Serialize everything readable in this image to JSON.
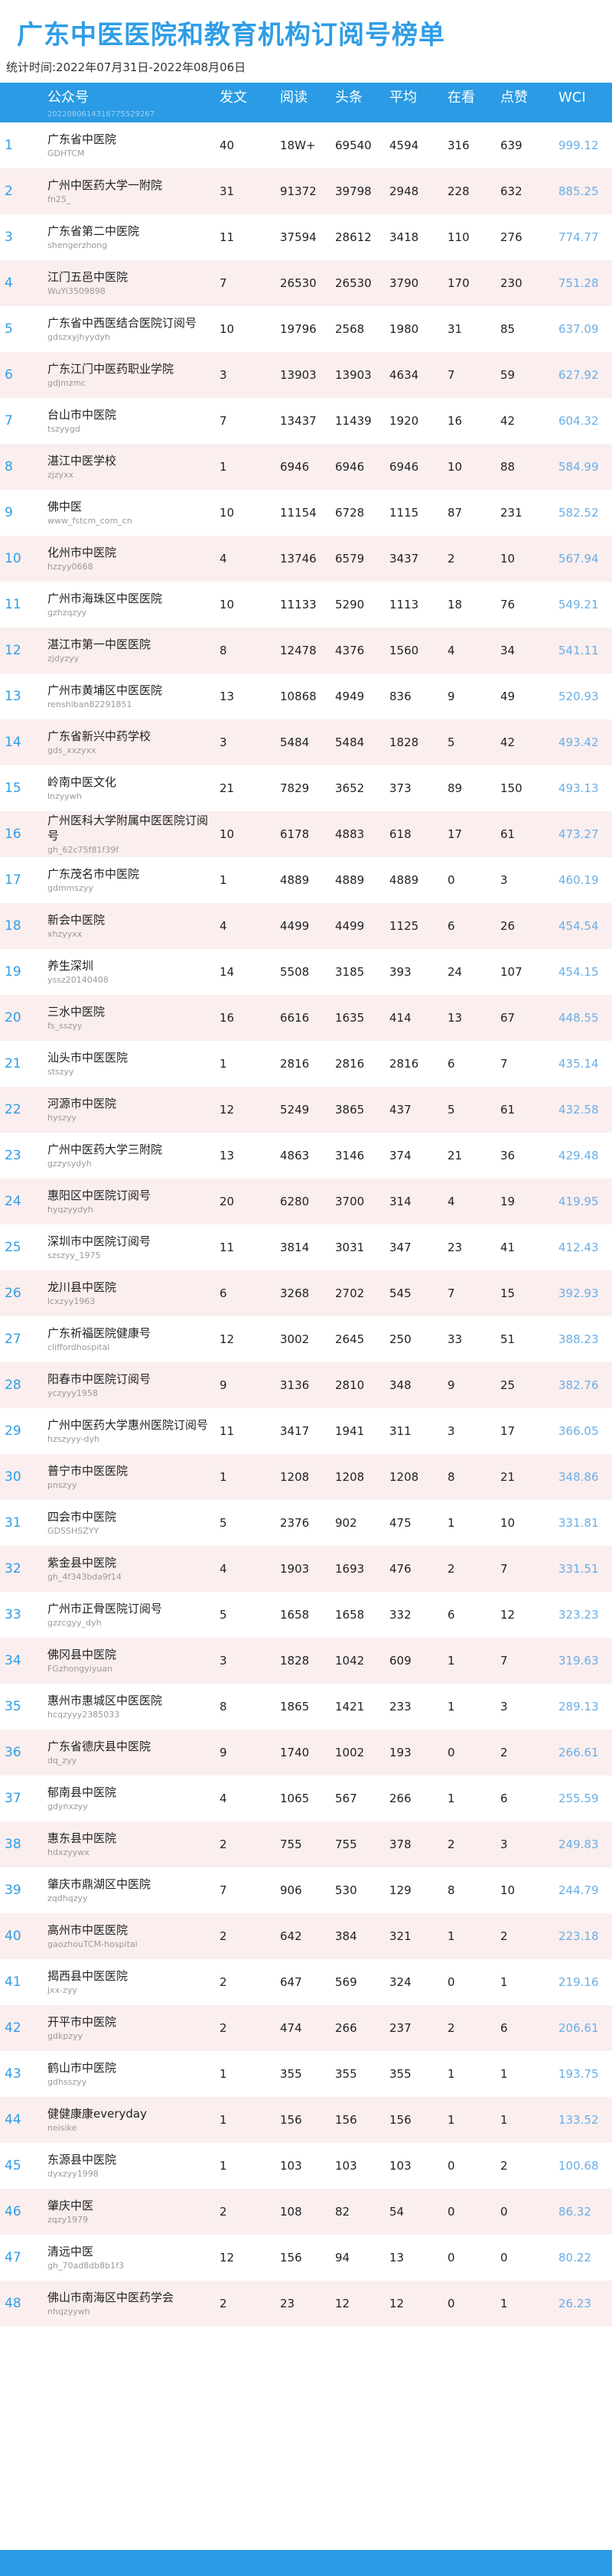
{
  "title": "广东中医医院和教育机构订阅号榜单",
  "period": "统计时间:2022年07月31日-2022年08月06日",
  "header": {
    "account": "公众号",
    "account_sub": "2022080614316775529267",
    "posts": "发文",
    "reads": "阅读",
    "headline": "头条",
    "avg": "平均",
    "looking": "在看",
    "likes": "点赞",
    "wci": "WCI"
  },
  "colors": {
    "accent": "#2a9be4",
    "title": "#2f9de6",
    "alt_row": "#fbeeee",
    "wci_text": "#6aaee6"
  },
  "rows": [
    {
      "rank": "1",
      "name": "广东省中医院",
      "acct": "GDHTCM",
      "posts": "40",
      "reads": "18W+",
      "head": "69540",
      "avg": "4594",
      "look": "316",
      "like": "639",
      "wci": "999.12"
    },
    {
      "rank": "2",
      "name": "广州中医药大学一附院",
      "acct": "fn25_",
      "posts": "31",
      "reads": "91372",
      "head": "39798",
      "avg": "2948",
      "look": "228",
      "like": "632",
      "wci": "885.25"
    },
    {
      "rank": "3",
      "name": "广东省第二中医院",
      "acct": "shengerzhong",
      "posts": "11",
      "reads": "37594",
      "head": "28612",
      "avg": "3418",
      "look": "110",
      "like": "276",
      "wci": "774.77"
    },
    {
      "rank": "4",
      "name": "江门五邑中医院",
      "acct": "WuYi3509898",
      "posts": "7",
      "reads": "26530",
      "head": "26530",
      "avg": "3790",
      "look": "170",
      "like": "230",
      "wci": "751.28"
    },
    {
      "rank": "5",
      "name": "广东省中西医结合医院订阅号",
      "acct": "gdszxyjhyydyh",
      "posts": "10",
      "reads": "19796",
      "head": "2568",
      "avg": "1980",
      "look": "31",
      "like": "85",
      "wci": "637.09"
    },
    {
      "rank": "6",
      "name": "广东江门中医药职业学院",
      "acct": "gdjmzmc",
      "posts": "3",
      "reads": "13903",
      "head": "13903",
      "avg": "4634",
      "look": "7",
      "like": "59",
      "wci": "627.92"
    },
    {
      "rank": "7",
      "name": "台山市中医院",
      "acct": "tszyygd",
      "posts": "7",
      "reads": "13437",
      "head": "11439",
      "avg": "1920",
      "look": "16",
      "like": "42",
      "wci": "604.32"
    },
    {
      "rank": "8",
      "name": "湛江中医学校",
      "acct": "zjzyxx",
      "posts": "1",
      "reads": "6946",
      "head": "6946",
      "avg": "6946",
      "look": "10",
      "like": "88",
      "wci": "584.99"
    },
    {
      "rank": "9",
      "name": "佛中医",
      "acct": "www_fstcm_com_cn",
      "posts": "10",
      "reads": "11154",
      "head": "6728",
      "avg": "1115",
      "look": "87",
      "like": "231",
      "wci": "582.52"
    },
    {
      "rank": "10",
      "name": "化州市中医院",
      "acct": "hzzyy0668",
      "posts": "4",
      "reads": "13746",
      "head": "6579",
      "avg": "3437",
      "look": "2",
      "like": "10",
      "wci": "567.94"
    },
    {
      "rank": "11",
      "name": "广州市海珠区中医医院",
      "acct": "gzhzqzyy",
      "posts": "10",
      "reads": "11133",
      "head": "5290",
      "avg": "1113",
      "look": "18",
      "like": "76",
      "wci": "549.21"
    },
    {
      "rank": "12",
      "name": "湛江市第一中医医院",
      "acct": "zjdyzyy",
      "posts": "8",
      "reads": "12478",
      "head": "4376",
      "avg": "1560",
      "look": "4",
      "like": "34",
      "wci": "541.11"
    },
    {
      "rank": "13",
      "name": "广州市黄埔区中医医院",
      "acct": "renshiban82291851",
      "posts": "13",
      "reads": "10868",
      "head": "4949",
      "avg": "836",
      "look": "9",
      "like": "49",
      "wci": "520.93"
    },
    {
      "rank": "14",
      "name": "广东省新兴中药学校",
      "acct": "gds_xxzyxx",
      "posts": "3",
      "reads": "5484",
      "head": "5484",
      "avg": "1828",
      "look": "5",
      "like": "42",
      "wci": "493.42"
    },
    {
      "rank": "15",
      "name": "岭南中医文化",
      "acct": "lnzyywh",
      "posts": "21",
      "reads": "7829",
      "head": "3652",
      "avg": "373",
      "look": "89",
      "like": "150",
      "wci": "493.13"
    },
    {
      "rank": "16",
      "name": "广州医科大学附属中医医院订阅号",
      "acct": "gh_62c75f81f39f",
      "posts": "10",
      "reads": "6178",
      "head": "4883",
      "avg": "618",
      "look": "17",
      "like": "61",
      "wci": "473.27"
    },
    {
      "rank": "17",
      "name": "广东茂名市中医院",
      "acct": "gdmmszyy",
      "posts": "1",
      "reads": "4889",
      "head": "4889",
      "avg": "4889",
      "look": "0",
      "like": "3",
      "wci": "460.19"
    },
    {
      "rank": "18",
      "name": "新会中医院",
      "acct": "xhzyyxx",
      "posts": "4",
      "reads": "4499",
      "head": "4499",
      "avg": "1125",
      "look": "6",
      "like": "26",
      "wci": "454.54"
    },
    {
      "rank": "19",
      "name": "养生深圳",
      "acct": "yssz20140408",
      "posts": "14",
      "reads": "5508",
      "head": "3185",
      "avg": "393",
      "look": "24",
      "like": "107",
      "wci": "454.15"
    },
    {
      "rank": "20",
      "name": "三水中医院",
      "acct": "fs_sszyy",
      "posts": "16",
      "reads": "6616",
      "head": "1635",
      "avg": "414",
      "look": "13",
      "like": "67",
      "wci": "448.55"
    },
    {
      "rank": "21",
      "name": "汕头市中医医院",
      "acct": "stszyy",
      "posts": "1",
      "reads": "2816",
      "head": "2816",
      "avg": "2816",
      "look": "6",
      "like": "7",
      "wci": "435.14"
    },
    {
      "rank": "22",
      "name": "河源市中医院",
      "acct": "hyszyy",
      "posts": "12",
      "reads": "5249",
      "head": "3865",
      "avg": "437",
      "look": "5",
      "like": "61",
      "wci": "432.58"
    },
    {
      "rank": "23",
      "name": "广州中医药大学三附院",
      "acct": "gzzysydyh",
      "posts": "13",
      "reads": "4863",
      "head": "3146",
      "avg": "374",
      "look": "21",
      "like": "36",
      "wci": "429.48"
    },
    {
      "rank": "24",
      "name": "惠阳区中医院订阅号",
      "acct": "hyqzyydyh",
      "posts": "20",
      "reads": "6280",
      "head": "3700",
      "avg": "314",
      "look": "4",
      "like": "19",
      "wci": "419.95"
    },
    {
      "rank": "25",
      "name": "深圳市中医院订阅号",
      "acct": "szszyy_1975",
      "posts": "11",
      "reads": "3814",
      "head": "3031",
      "avg": "347",
      "look": "23",
      "like": "41",
      "wci": "412.43"
    },
    {
      "rank": "26",
      "name": "龙川县中医院",
      "acct": "lcxzyy1963",
      "posts": "6",
      "reads": "3268",
      "head": "2702",
      "avg": "545",
      "look": "7",
      "like": "15",
      "wci": "392.93"
    },
    {
      "rank": "27",
      "name": "广东祈福医院健康号",
      "acct": "cliffordhospital",
      "posts": "12",
      "reads": "3002",
      "head": "2645",
      "avg": "250",
      "look": "33",
      "like": "51",
      "wci": "388.23"
    },
    {
      "rank": "28",
      "name": "阳春市中医院订阅号",
      "acct": "yczyyy1958",
      "posts": "9",
      "reads": "3136",
      "head": "2810",
      "avg": "348",
      "look": "9",
      "like": "25",
      "wci": "382.76"
    },
    {
      "rank": "29",
      "name": "广州中医药大学惠州医院订阅号",
      "acct": "hzszyyy-dyh",
      "posts": "11",
      "reads": "3417",
      "head": "1941",
      "avg": "311",
      "look": "3",
      "like": "17",
      "wci": "366.05"
    },
    {
      "rank": "30",
      "name": "普宁市中医医院",
      "acct": "pnszyy",
      "posts": "1",
      "reads": "1208",
      "head": "1208",
      "avg": "1208",
      "look": "8",
      "like": "21",
      "wci": "348.86"
    },
    {
      "rank": "31",
      "name": "四会市中医院",
      "acct": "GDSSHSZYY",
      "posts": "5",
      "reads": "2376",
      "head": "902",
      "avg": "475",
      "look": "1",
      "like": "10",
      "wci": "331.81"
    },
    {
      "rank": "32",
      "name": "紫金县中医院",
      "acct": "gh_4f343bda9f14",
      "posts": "4",
      "reads": "1903",
      "head": "1693",
      "avg": "476",
      "look": "2",
      "like": "7",
      "wci": "331.51"
    },
    {
      "rank": "33",
      "name": "广州市正骨医院订阅号",
      "acct": "gzzcgyy_dyh",
      "posts": "5",
      "reads": "1658",
      "head": "1658",
      "avg": "332",
      "look": "6",
      "like": "12",
      "wci": "323.23"
    },
    {
      "rank": "34",
      "name": "佛冈县中医院",
      "acct": "FGzhongyiyuan",
      "posts": "3",
      "reads": "1828",
      "head": "1042",
      "avg": "609",
      "look": "1",
      "like": "7",
      "wci": "319.63"
    },
    {
      "rank": "35",
      "name": "惠州市惠城区中医医院",
      "acct": "hcqzyyy2385033",
      "posts": "8",
      "reads": "1865",
      "head": "1421",
      "avg": "233",
      "look": "1",
      "like": "3",
      "wci": "289.13"
    },
    {
      "rank": "36",
      "name": "广东省德庆县中医院",
      "acct": "dq_zyy",
      "posts": "9",
      "reads": "1740",
      "head": "1002",
      "avg": "193",
      "look": "0",
      "like": "2",
      "wci": "266.61"
    },
    {
      "rank": "37",
      "name": "郁南县中医院",
      "acct": "gdynxzyy",
      "posts": "4",
      "reads": "1065",
      "head": "567",
      "avg": "266",
      "look": "1",
      "like": "6",
      "wci": "255.59"
    },
    {
      "rank": "38",
      "name": "惠东县中医院",
      "acct": "hdxzyywx",
      "posts": "2",
      "reads": "755",
      "head": "755",
      "avg": "378",
      "look": "2",
      "like": "3",
      "wci": "249.83"
    },
    {
      "rank": "39",
      "name": "肇庆市鼎湖区中医院",
      "acct": "zqdhqzyy",
      "posts": "7",
      "reads": "906",
      "head": "530",
      "avg": "129",
      "look": "8",
      "like": "10",
      "wci": "244.79"
    },
    {
      "rank": "40",
      "name": "高州市中医医院",
      "acct": "gaozhouTCM-hospital",
      "posts": "2",
      "reads": "642",
      "head": "384",
      "avg": "321",
      "look": "1",
      "like": "2",
      "wci": "223.18"
    },
    {
      "rank": "41",
      "name": "揭西县中医医院",
      "acct": "jxx-zyy",
      "posts": "2",
      "reads": "647",
      "head": "569",
      "avg": "324",
      "look": "0",
      "like": "1",
      "wci": "219.16"
    },
    {
      "rank": "42",
      "name": "开平市中医院",
      "acct": "gdkpzyy",
      "posts": "2",
      "reads": "474",
      "head": "266",
      "avg": "237",
      "look": "2",
      "like": "6",
      "wci": "206.61"
    },
    {
      "rank": "43",
      "name": "鹤山市中医院",
      "acct": "gdhsszyy",
      "posts": "1",
      "reads": "355",
      "head": "355",
      "avg": "355",
      "look": "1",
      "like": "1",
      "wci": "193.75"
    },
    {
      "rank": "44",
      "name": "健健康康everyday",
      "acct": "neisike",
      "posts": "1",
      "reads": "156",
      "head": "156",
      "avg": "156",
      "look": "1",
      "like": "1",
      "wci": "133.52"
    },
    {
      "rank": "45",
      "name": "东源县中医院",
      "acct": "dyxzyy1998",
      "posts": "1",
      "reads": "103",
      "head": "103",
      "avg": "103",
      "look": "0",
      "like": "2",
      "wci": "100.68"
    },
    {
      "rank": "46",
      "name": "肇庆中医",
      "acct": "zqzy1979",
      "posts": "2",
      "reads": "108",
      "head": "82",
      "avg": "54",
      "look": "0",
      "like": "0",
      "wci": "86.32"
    },
    {
      "rank": "47",
      "name": "清远中医",
      "acct": "gh_70ad8db8b1f3",
      "posts": "12",
      "reads": "156",
      "head": "94",
      "avg": "13",
      "look": "0",
      "like": "0",
      "wci": "80.22"
    },
    {
      "rank": "48",
      "name": "佛山市南海区中医药学会",
      "acct": "nhqzyywh",
      "posts": "2",
      "reads": "23",
      "head": "12",
      "avg": "12",
      "look": "0",
      "like": "1",
      "wci": "26.23"
    }
  ]
}
